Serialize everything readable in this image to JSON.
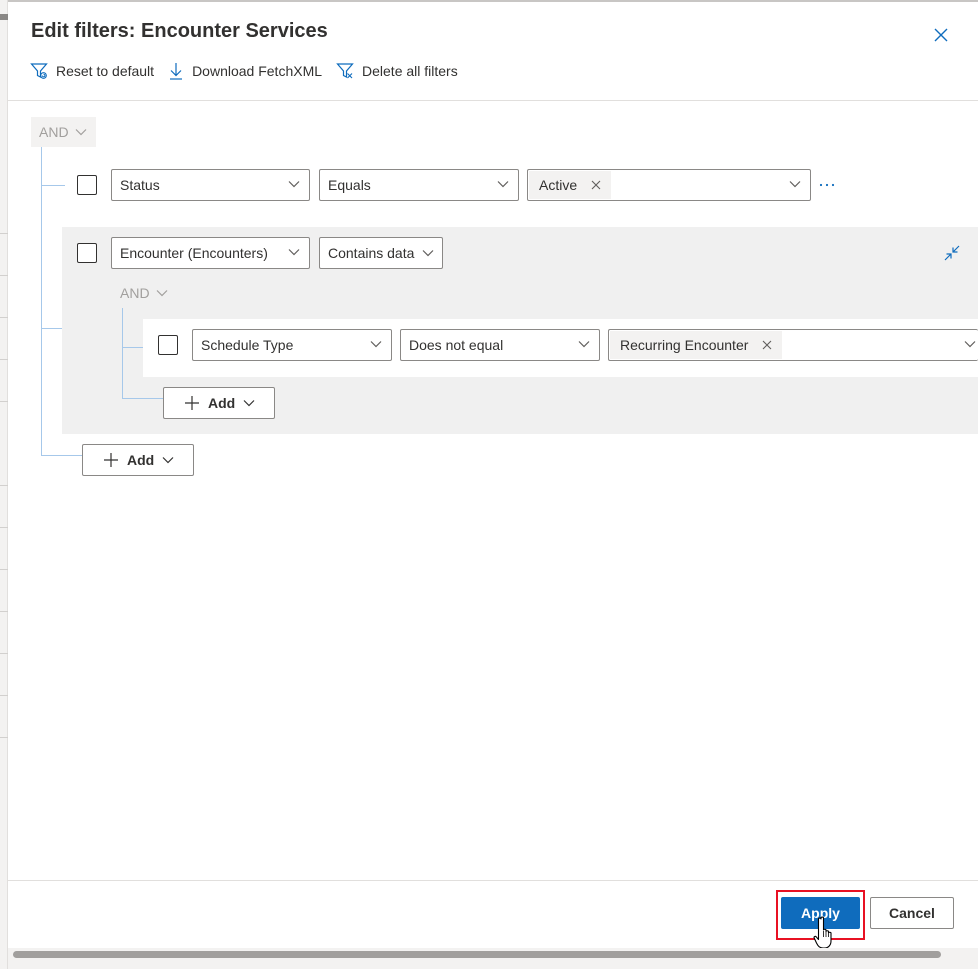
{
  "dialog": {
    "title": "Edit filters: Encounter Services"
  },
  "toolbar": {
    "reset_label": "Reset to default",
    "download_label": "Download FetchXML",
    "delete_label": "Delete all filters"
  },
  "filter": {
    "root_operator": "AND",
    "rows": [
      {
        "field": "Status",
        "operator": "Equals",
        "values": [
          "Active"
        ]
      }
    ],
    "related_group": {
      "entity": "Encounter (Encounters)",
      "operator": "Contains data",
      "group_operator": "AND",
      "rows": [
        {
          "field": "Schedule Type",
          "operator": "Does not equal",
          "values": [
            "Recurring Encounter"
          ]
        }
      ],
      "add_label": "Add"
    },
    "add_label": "Add"
  },
  "footer": {
    "apply_label": "Apply",
    "cancel_label": "Cancel"
  },
  "colors": {
    "primary": "#0f6cbd",
    "tree_line": "#a6c8ea",
    "highlight_frame": "#e81123"
  },
  "icons": [
    "filter-reset-icon",
    "download-icon",
    "filter-delete-icon",
    "close-icon",
    "chevron-down-icon",
    "more-icon",
    "collapse-icon",
    "plus-icon",
    "hand-cursor-icon"
  ]
}
